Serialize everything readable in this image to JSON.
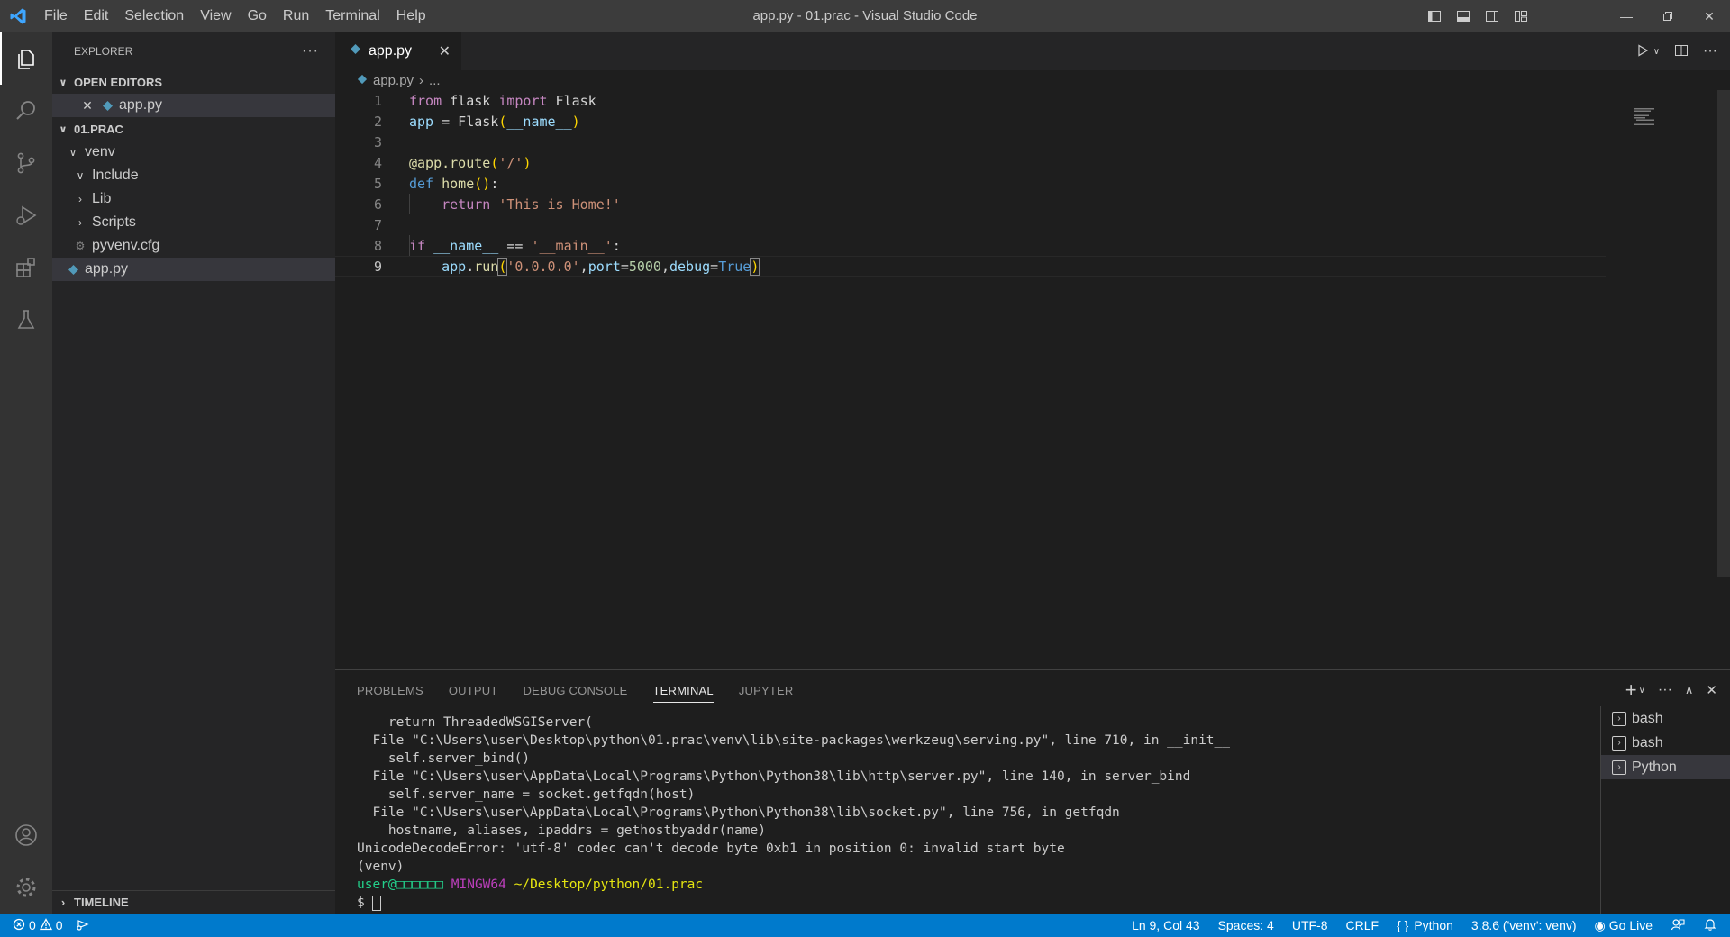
{
  "window": {
    "title": "app.py - 01.prac - Visual Studio Code"
  },
  "menu": [
    "File",
    "Edit",
    "Selection",
    "View",
    "Go",
    "Run",
    "Terminal",
    "Help"
  ],
  "sidebar": {
    "title": "EXPLORER",
    "open_editors_label": "OPEN EDITORS",
    "open_editor_file": "app.py",
    "folder_label": "01.PRAC",
    "tree": [
      {
        "label": "venv",
        "kind": "folder-open"
      },
      {
        "label": "Include",
        "kind": "folder-open"
      },
      {
        "label": "Lib",
        "kind": "folder"
      },
      {
        "label": "Scripts",
        "kind": "folder"
      },
      {
        "label": "pyvenv.cfg",
        "kind": "gear-file"
      },
      {
        "label": "app.py",
        "kind": "python-file"
      }
    ],
    "timeline_label": "TIMELINE"
  },
  "editor": {
    "tab_label": "app.py",
    "breadcrumb_file": "app.py",
    "breadcrumb_more": "...",
    "line_numbers": [
      "1",
      "2",
      "3",
      "4",
      "5",
      "6",
      "7",
      "8",
      "9"
    ]
  },
  "panel": {
    "tabs": [
      "PROBLEMS",
      "OUTPUT",
      "DEBUG CONSOLE",
      "TERMINAL",
      "JUPYTER"
    ],
    "active_tab": "TERMINAL",
    "terminal_lines": [
      "    return ThreadedWSGIServer(",
      "  File \"C:\\Users\\user\\Desktop\\python\\01.prac\\venv\\lib\\site-packages\\werkzeug\\serving.py\", line 710, in __init__",
      "    self.server_bind()",
      "  File \"C:\\Users\\user\\AppData\\Local\\Programs\\Python\\Python38\\lib\\http\\server.py\", line 140, in server_bind",
      "    self.server_name = socket.getfqdn(host)",
      "  File \"C:\\Users\\user\\AppData\\Local\\Programs\\Python\\Python38\\lib\\socket.py\", line 756, in getfqdn",
      "    hostname, aliases, ipaddrs = gethostbyaddr(name)",
      "UnicodeDecodeError: 'utf-8' codec can't decode byte 0xb1 in position 0: invalid start byte",
      "(venv)"
    ],
    "prompt": {
      "user": "user@□□□□□□",
      "system": "MINGW64",
      "path": "~/Desktop/python/01.prac",
      "symbol": "$"
    },
    "terminal_instances": [
      "bash",
      "bash",
      "Python"
    ]
  },
  "statusbar": {
    "errors": "0",
    "warnings": "0",
    "position": "Ln 9, Col 43",
    "spaces": "Spaces: 4",
    "encoding": "UTF-8",
    "eol": "CRLF",
    "language": "Python",
    "interpreter": "3.8.6 ('venv': venv)",
    "golive": "Go Live"
  }
}
